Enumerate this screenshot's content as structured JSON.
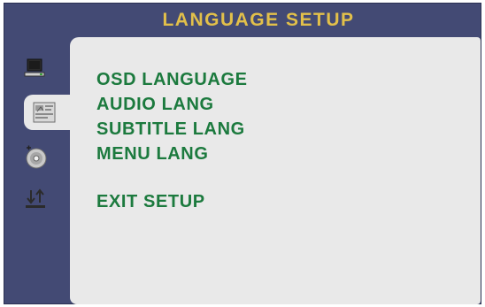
{
  "header": {
    "title": "LANGUAGE SETUP"
  },
  "sidebar": {
    "items": [
      {
        "icon": "monitor-icon",
        "selected": false
      },
      {
        "icon": "language-icon",
        "selected": true
      },
      {
        "icon": "disc-icon",
        "selected": false
      },
      {
        "icon": "download-upload-icon",
        "selected": false
      }
    ]
  },
  "menu": {
    "items": [
      {
        "label": "OSD LANGUAGE"
      },
      {
        "label": "AUDIO LANG"
      },
      {
        "label": "SUBTITLE LANG"
      },
      {
        "label": "MENU LANG"
      },
      {
        "label": "EXIT SETUP"
      }
    ]
  },
  "colors": {
    "frame": "#434a74",
    "panel": "#e9e9e9",
    "title": "#e2c04a",
    "menu_text": "#1c7a3e"
  }
}
